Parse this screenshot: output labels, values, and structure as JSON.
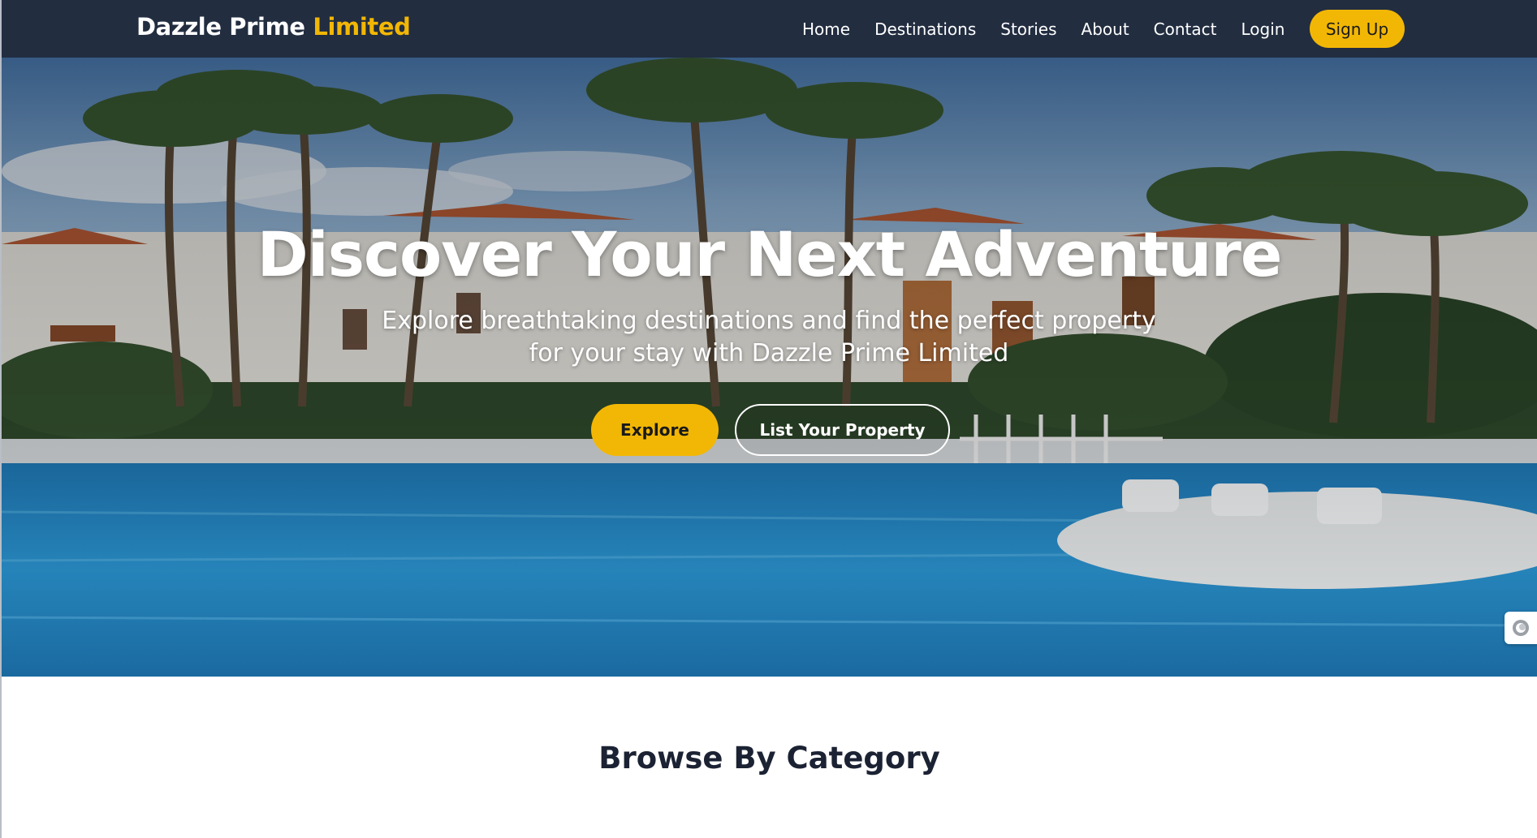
{
  "navbar": {
    "brand_main": "Dazzle Prime",
    "brand_accent": "Limited",
    "links": [
      "Home",
      "Destinations",
      "Stories",
      "About",
      "Contact",
      "Login"
    ],
    "signup_label": "Sign Up"
  },
  "hero": {
    "title": "Discover Your Next Adventure",
    "subtitle_line1": "Explore breathtaking destinations and find the perfect property",
    "subtitle_line2": "for your stay with Dazzle Prime Limited",
    "explore_label": "Explore",
    "list_label": "List Your Property",
    "side_widget_icon": "circle-toggle-icon"
  },
  "category": {
    "heading": "Browse By Category"
  },
  "colors": {
    "navbar_bg": "#222d40",
    "accent": "#f2b705",
    "heading_dark": "#1b2233"
  }
}
